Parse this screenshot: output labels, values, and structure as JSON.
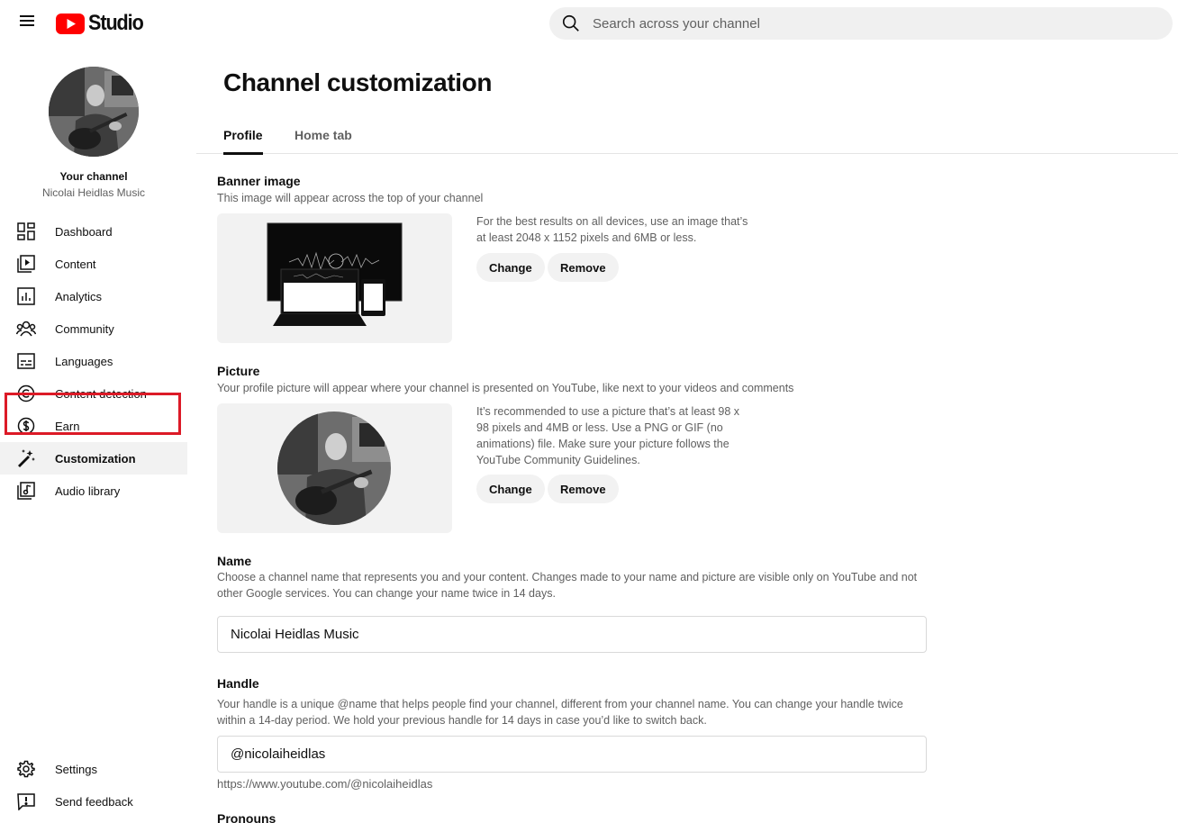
{
  "header": {
    "logo_text": "Studio",
    "search_placeholder": "Search across your channel"
  },
  "sidebar": {
    "your_channel": "Your channel",
    "channel_name": "Nicolai Heidlas Music",
    "items": [
      {
        "label": "Dashboard",
        "icon": "dashboard-icon"
      },
      {
        "label": "Content",
        "icon": "content-icon"
      },
      {
        "label": "Analytics",
        "icon": "analytics-icon"
      },
      {
        "label": "Community",
        "icon": "community-icon"
      },
      {
        "label": "Languages",
        "icon": "subtitles-icon"
      },
      {
        "label": "Content detection",
        "icon": "copyright-icon"
      },
      {
        "label": "Earn",
        "icon": "dollar-icon"
      },
      {
        "label": "Customization",
        "icon": "magic-wand-icon",
        "active": true
      },
      {
        "label": "Audio library",
        "icon": "audio-library-icon"
      }
    ],
    "bottom_items": [
      {
        "label": "Settings",
        "icon": "gear-icon"
      },
      {
        "label": "Send feedback",
        "icon": "feedback-icon"
      }
    ],
    "highlight_color": "#dc1a27"
  },
  "main": {
    "title": "Channel customization",
    "tabs": [
      {
        "label": "Profile",
        "active": true
      },
      {
        "label": "Home tab",
        "active": false
      }
    ],
    "banner": {
      "title": "Banner image",
      "description": "This image will appear across the top of your channel",
      "hint_line1": "For the best results on all devices, use an image that’s",
      "hint_line2": "at least 2048 x 1152 pixels and 6MB or less.",
      "change_label": "Change",
      "remove_label": "Remove"
    },
    "picture": {
      "title": "Picture",
      "description": "Your profile picture will appear where your channel is presented on YouTube, like next to your videos and comments",
      "hint_line1": "It’s recommended to use a picture that’s at least 98 x",
      "hint_line2": "98 pixels and 4MB or less. Use a PNG or GIF (no",
      "hint_line3": "animations) file. Make sure your picture follows the",
      "hint_line4": "YouTube Community Guidelines.",
      "change_label": "Change",
      "remove_label": "Remove"
    },
    "name": {
      "title": "Name",
      "description_line1": "Choose a channel name that represents you and your content. Changes made to your name and picture are visible only on YouTube and not",
      "description_line2": "other Google services. You can change your name twice in 14 days.",
      "value": "Nicolai Heidlas Music"
    },
    "handle": {
      "title": "Handle",
      "description_line1": "Your handle is a unique @name that helps people find your channel, different from your channel name. You can change your handle twice",
      "description_line2": "within a 14-day period. We hold your previous handle for 14 days in case you’d like to switch back.",
      "value": "@nicolaiheidlas",
      "url": "https://www.youtube.com/@nicolaiheidlas"
    },
    "pronouns": {
      "title": "Pronouns"
    }
  }
}
